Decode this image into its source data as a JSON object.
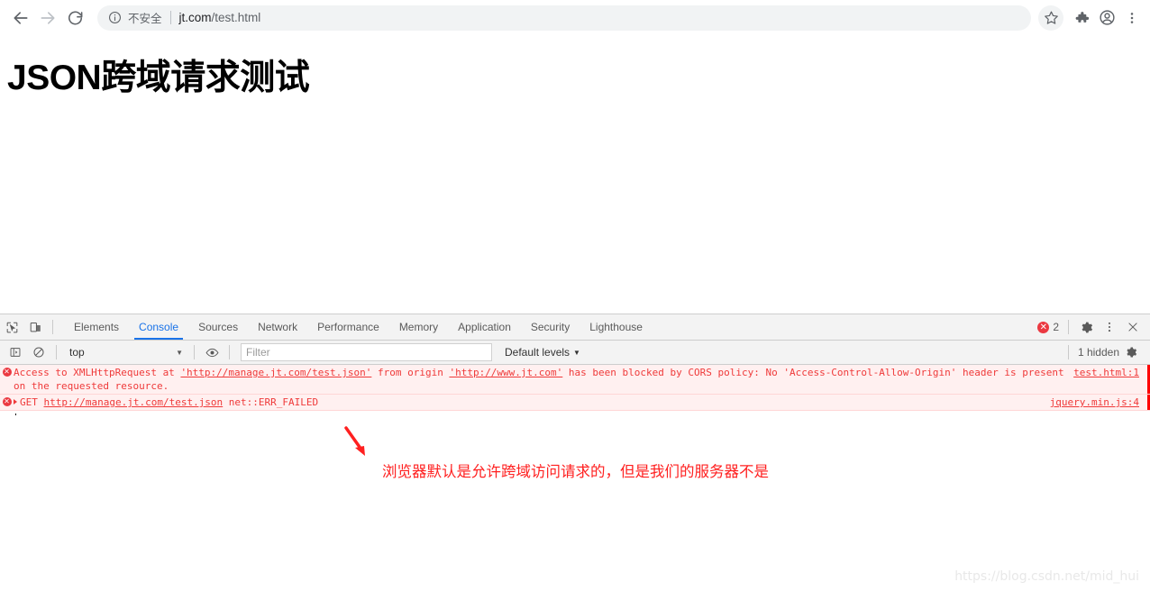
{
  "browser": {
    "nav": {
      "back_label": "Back",
      "forward_label": "Forward",
      "reload_label": "Reload"
    },
    "omnibox": {
      "security_label": "不安全",
      "url_host": "jt.com",
      "url_path": "/test.html",
      "info_icon": "info-circle-icon"
    },
    "toolbar": {
      "bookmark_icon": "star-icon",
      "extensions_icon": "puzzle-piece-icon",
      "profile_icon": "account-circle-icon",
      "menu_icon": "three-dot-menu-icon"
    }
  },
  "page": {
    "title": "JSON跨域请求测试"
  },
  "devtools": {
    "left_icons": [
      {
        "name": "inspect-element-icon",
        "label": "Inspect element"
      },
      {
        "name": "device-toolbar-icon",
        "label": "Toggle device toolbar"
      }
    ],
    "tabs": [
      {
        "label": "Elements",
        "active": false
      },
      {
        "label": "Console",
        "active": true
      },
      {
        "label": "Sources",
        "active": false
      },
      {
        "label": "Network",
        "active": false
      },
      {
        "label": "Performance",
        "active": false
      },
      {
        "label": "Memory",
        "active": false
      },
      {
        "label": "Application",
        "active": false
      },
      {
        "label": "Security",
        "active": false
      },
      {
        "label": "Lighthouse",
        "active": false
      }
    ],
    "error_badge": {
      "symbol": "✕",
      "count": "2"
    },
    "header_actions": {
      "settings_icon": "gear-icon",
      "more_icon": "three-dot-menu-icon",
      "close_icon": "close-x-icon"
    },
    "filterbar": {
      "sidebar_toggle_icon": "console-sidebar-icon",
      "clear_icon": "clear-console-icon",
      "context": "top",
      "context_caret": "▼",
      "eye_icon": "live-expression-eye-icon",
      "filter_placeholder": "Filter",
      "filter_value": "",
      "levels_label": "Default levels",
      "levels_caret": "▼",
      "hidden_label": "1 hidden",
      "hidden_settings_icon": "gear-icon"
    },
    "console_messages": [
      {
        "level": "error",
        "icon": "error-circle-icon",
        "has_disclosure": false,
        "parts": [
          {
            "text": "Access to XMLHttpRequest at ",
            "link": false
          },
          {
            "text": "'http://manage.jt.com/test.json'",
            "link": true
          },
          {
            "text": " from origin ",
            "link": false
          },
          {
            "text": "'http://www.jt.com'",
            "link": true
          },
          {
            "text": " has been blocked by CORS policy: No 'Access-Control-Allow-Origin' header is present on the requested resource.",
            "link": false
          }
        ],
        "source": "test.html:1"
      },
      {
        "level": "error",
        "icon": "error-circle-icon",
        "has_disclosure": true,
        "parts": [
          {
            "text": "GET ",
            "link": false
          },
          {
            "text": "http://manage.jt.com/test.json",
            "link": true
          },
          {
            "text": " net::ERR_FAILED",
            "link": false
          }
        ],
        "source": "jquery.min.js:4"
      }
    ],
    "prompt": {
      "chevron": ">",
      "value": ""
    }
  },
  "annotation": {
    "arrow_name": "red-arrow-annotation",
    "text": "浏览器默认是允许跨域访问请求的，但是我们的服务器不是",
    "color": "#ff2020"
  },
  "watermark": {
    "text": "https://blog.csdn.net/mid_hui"
  }
}
